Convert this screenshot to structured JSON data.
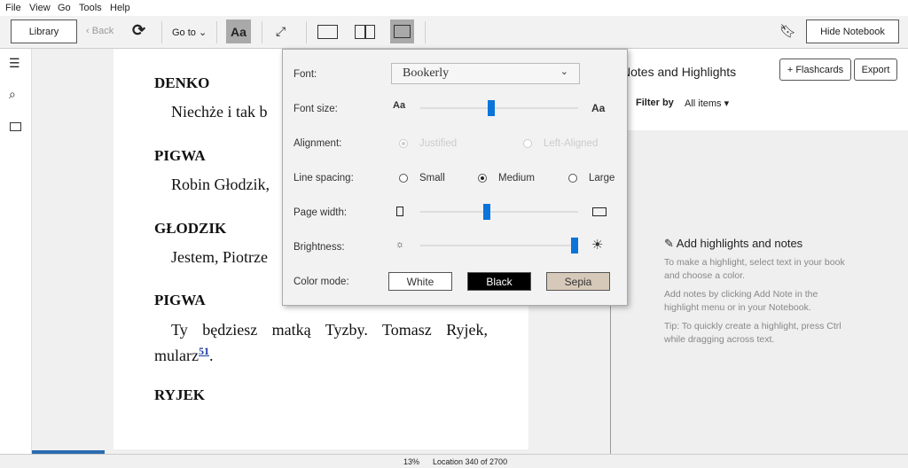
{
  "menu": [
    "File",
    "View",
    "Go",
    "Tools",
    "Help"
  ],
  "toolbar": {
    "library": "Library",
    "back": "Back",
    "goto": "Go to",
    "font_button": "Aa",
    "hide_notebook": "Hide Notebook"
  },
  "book": {
    "blocks": [
      {
        "speaker": "DENKO",
        "text": "Niechże i tak b"
      },
      {
        "speaker": "PIGWA",
        "text": "Robin Głodzik,"
      },
      {
        "speaker": "GŁODZIK",
        "text": "Jestem, Piotrze"
      },
      {
        "speaker": "PIGWA",
        "text": "Ty będziesz matką Tyzby. Tomasz Ryjek, mularz",
        "footnote": "51",
        "after": "."
      },
      {
        "speaker": "RYJEK",
        "text": ""
      }
    ]
  },
  "settings": {
    "font_label": "Font:",
    "font_value": "Bookerly",
    "font_size_label": "Font size:",
    "font_size_value": 0.45,
    "alignment_label": "Alignment:",
    "alignment_options": [
      "Justified",
      "Left-Aligned"
    ],
    "alignment_selected": "Justified",
    "alignment_disabled": true,
    "line_spacing_label": "Line spacing:",
    "line_spacing_options": [
      "Small",
      "Medium",
      "Large"
    ],
    "line_spacing_selected": "Medium",
    "page_width_label": "Page width:",
    "page_width_value": 0.42,
    "brightness_label": "Brightness:",
    "brightness_value": 0.98,
    "color_mode_label": "Color mode:",
    "color_modes": [
      "White",
      "Black",
      "Sepia"
    ],
    "accent": "#0a74da",
    "sepia": "#d7c9b9"
  },
  "notebook": {
    "title": "Notes and Highlights",
    "flashcards": "+ Flashcards",
    "export": "Export",
    "filter_label": "Filter by",
    "filter_value": "All items",
    "empty_title": "Add highlights and notes",
    "tips": [
      "To make a highlight, select text in your book and choose a color.",
      "Add notes by clicking Add Note in the highlight menu or in your Notebook.",
      "Tip: To quickly create a highlight, press Ctrl while dragging across text."
    ]
  },
  "status": {
    "percent": "13%",
    "location": "Location 340 of 2700",
    "progress": 0.13
  }
}
